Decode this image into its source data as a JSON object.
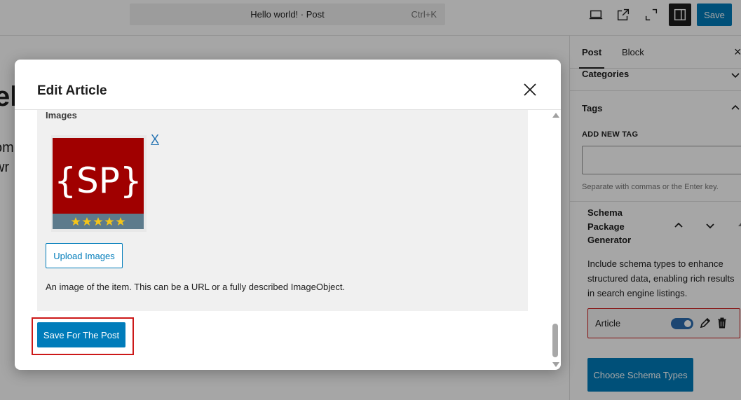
{
  "topbar": {
    "command_title": "Hello world! · Post",
    "command_shortcut": "Ctrl+K",
    "save_label": "Save",
    "icons": [
      "desktop-view-icon",
      "external-link-icon",
      "zoom-out-icon",
      "sidebar-toggle-icon"
    ]
  },
  "canvas": {
    "title_fragment": "ell",
    "para_line_1": "om",
    "para_line_2": "wr"
  },
  "sidebar": {
    "tab_post": "Post",
    "tab_block": "Block",
    "close_label": "×",
    "categories_label": "Categories",
    "tags_label": "Tags",
    "add_tag_label": "ADD NEW TAG",
    "tag_input_value": "",
    "tag_help": "Separate with commas or the Enter key.",
    "schema_title": "Schema Package Generator",
    "schema_desc": "Include schema types to enhance structured data, enabling rich results in search engine listings.",
    "schema_item_label": "Article",
    "schema_item_enabled": true,
    "choose_button": "Choose Schema Types"
  },
  "modal": {
    "title": "Edit Article",
    "images_label": "Images",
    "image_logo_text": "{SP}",
    "image_star_rating": 5,
    "remove_image_label": "X",
    "upload_button": "Upload Images",
    "images_description": "An image of the item. This can be a URL or a fully described ImageObject.",
    "save_button": "Save For The Post"
  },
  "colors": {
    "accent": "#007cba",
    "highlight_border": "#cc1818",
    "logo_red": "#a00000",
    "logo_band": "#5d7b8c",
    "star": "#f5c518"
  }
}
